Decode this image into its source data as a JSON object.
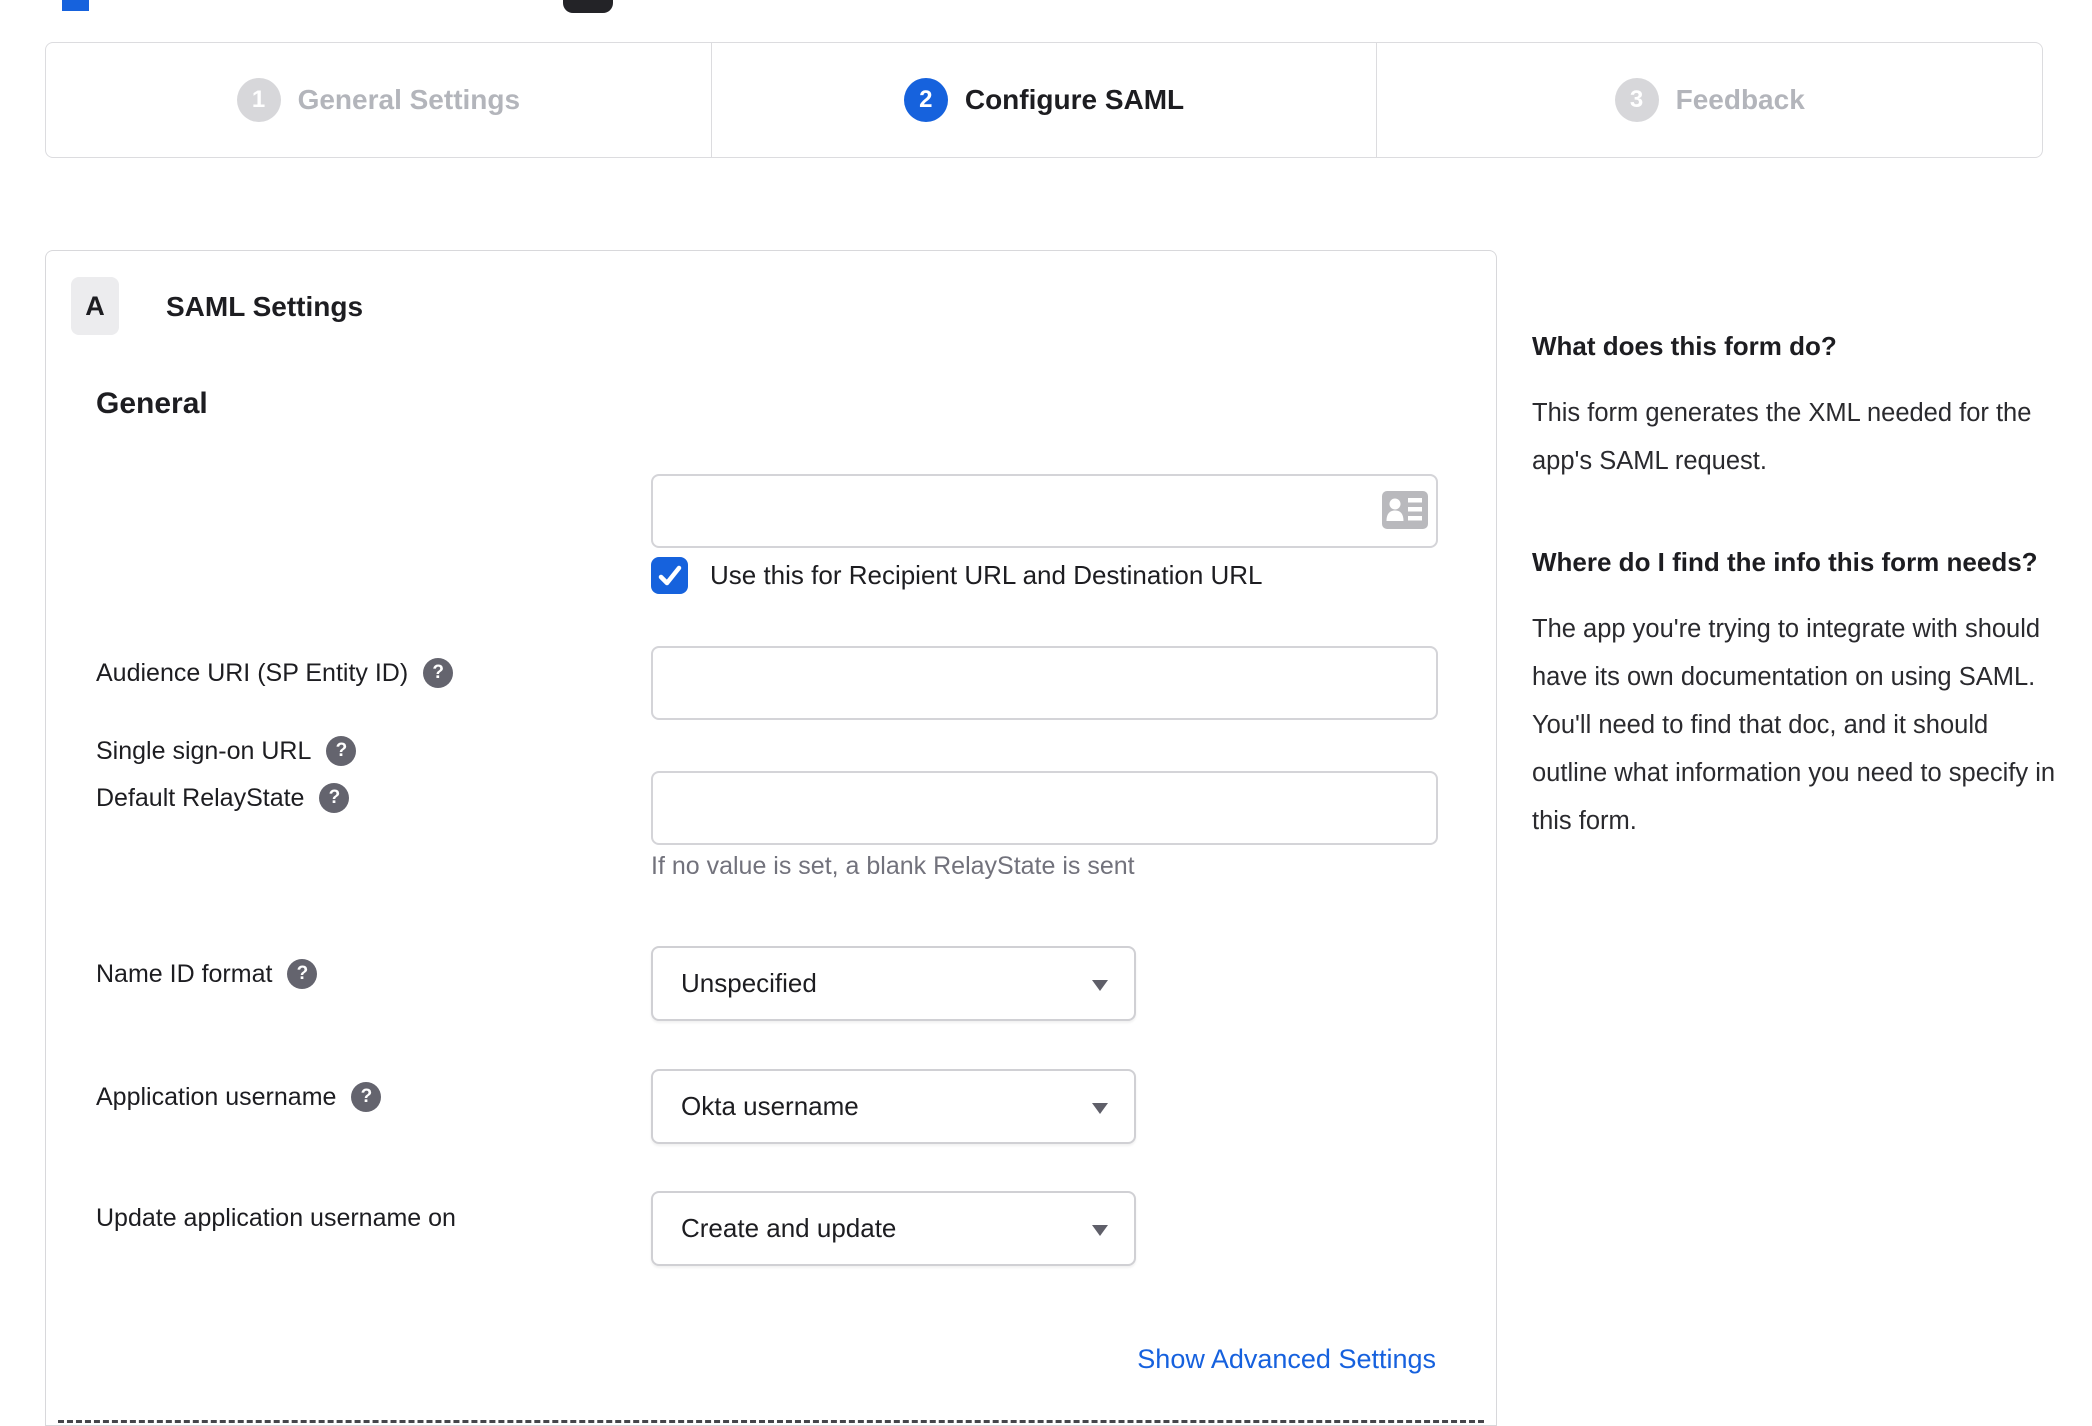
{
  "stepper": {
    "steps": [
      {
        "number": "1",
        "label": "General Settings"
      },
      {
        "number": "2",
        "label": "Configure SAML"
      },
      {
        "number": "3",
        "label": "Feedback"
      }
    ]
  },
  "panel": {
    "badge": "A",
    "title": "SAML Settings",
    "section_heading": "General",
    "fields": {
      "sso_url": {
        "label": "Single sign-on URL",
        "value": "",
        "checkbox_label": "Use this for Recipient URL and Destination URL",
        "checkbox_checked": true
      },
      "audience_uri": {
        "label": "Audience URI (SP Entity ID)",
        "value": ""
      },
      "default_relay_state": {
        "label": "Default RelayState",
        "value": "",
        "helper_text": "If no value is set, a blank RelayState is sent"
      },
      "name_id_format": {
        "label": "Name ID format",
        "selected": "Unspecified"
      },
      "application_username": {
        "label": "Application username",
        "selected": "Okta username"
      },
      "update_application_username_on": {
        "label": "Update application username on",
        "selected": "Create and update"
      }
    },
    "advanced_settings_link": "Show Advanced Settings"
  },
  "help_panel": {
    "sections": [
      {
        "heading": "What does this form do?",
        "body": "This form generates the XML needed for the app's SAML request."
      },
      {
        "heading": "Where do I find the info this form needs?",
        "body": "The app you're trying to integrate with should have its own documentation on using SAML. You'll need to find that doc, and it should outline what information you need to specify in this form."
      }
    ]
  },
  "colors": {
    "accent_blue": "#1662dd",
    "link_blue": "#1661de",
    "inactive_circle_gray": "#d7d7da",
    "inactive_label_gray": "#b3b5bb",
    "text_dark": "#1d1d21",
    "muted_text": "#72727c",
    "border_gray": "#d8d8db"
  }
}
